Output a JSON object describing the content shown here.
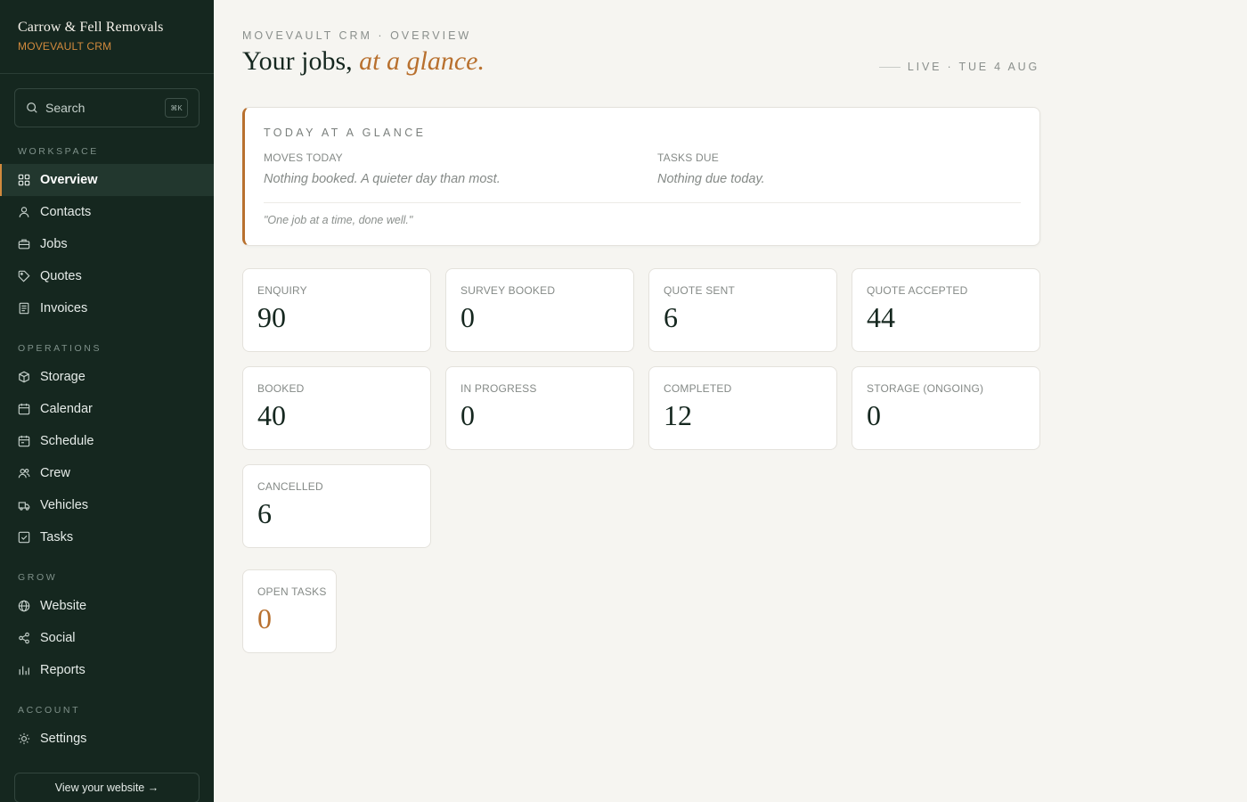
{
  "brand": {
    "name": "Carrow & Fell Removals",
    "sub": "MOVEVAULT CRM"
  },
  "search": {
    "placeholder": "Search",
    "shortcut": "⌘K"
  },
  "nav": {
    "sections": [
      {
        "label": "WORKSPACE",
        "items": [
          "Overview",
          "Contacts",
          "Jobs",
          "Quotes",
          "Invoices"
        ]
      },
      {
        "label": "OPERATIONS",
        "items": [
          "Storage",
          "Calendar",
          "Schedule",
          "Crew",
          "Vehicles",
          "Tasks"
        ]
      },
      {
        "label": "GROW",
        "items": [
          "Website",
          "Social",
          "Reports"
        ]
      },
      {
        "label": "ACCOUNT",
        "items": [
          "Settings"
        ]
      }
    ],
    "active": "Overview",
    "view_site": "View your website →"
  },
  "header": {
    "crumb": "MOVEVAULT CRM · OVERVIEW",
    "title_main": "Your jobs, ",
    "title_accent": "at a glance.",
    "live": "LIVE · TUE 4 AUG"
  },
  "glance": {
    "title": "TODAY AT A GLANCE",
    "moves_label": "MOVES TODAY",
    "moves_value": "Nothing booked. A quieter day than most.",
    "tasks_label": "TASKS DUE",
    "tasks_value": "Nothing due today.",
    "quote": "\"One job at a time, done well.\""
  },
  "stats": [
    {
      "label": "ENQUIRY",
      "value": "90"
    },
    {
      "label": "SURVEY BOOKED",
      "value": "0"
    },
    {
      "label": "QUOTE SENT",
      "value": "6"
    },
    {
      "label": "QUOTE ACCEPTED",
      "value": "44"
    },
    {
      "label": "BOOKED",
      "value": "40"
    },
    {
      "label": "IN PROGRESS",
      "value": "0"
    },
    {
      "label": "COMPLETED",
      "value": "12"
    },
    {
      "label": "STORAGE (ONGOING)",
      "value": "0"
    },
    {
      "label": "CANCELLED",
      "value": "6"
    }
  ],
  "open_tasks": {
    "label": "OPEN TASKS",
    "value": "0"
  },
  "colors": {
    "sidebar": "#15271f",
    "accent": "#b8702e",
    "background": "#f6f5f1"
  }
}
